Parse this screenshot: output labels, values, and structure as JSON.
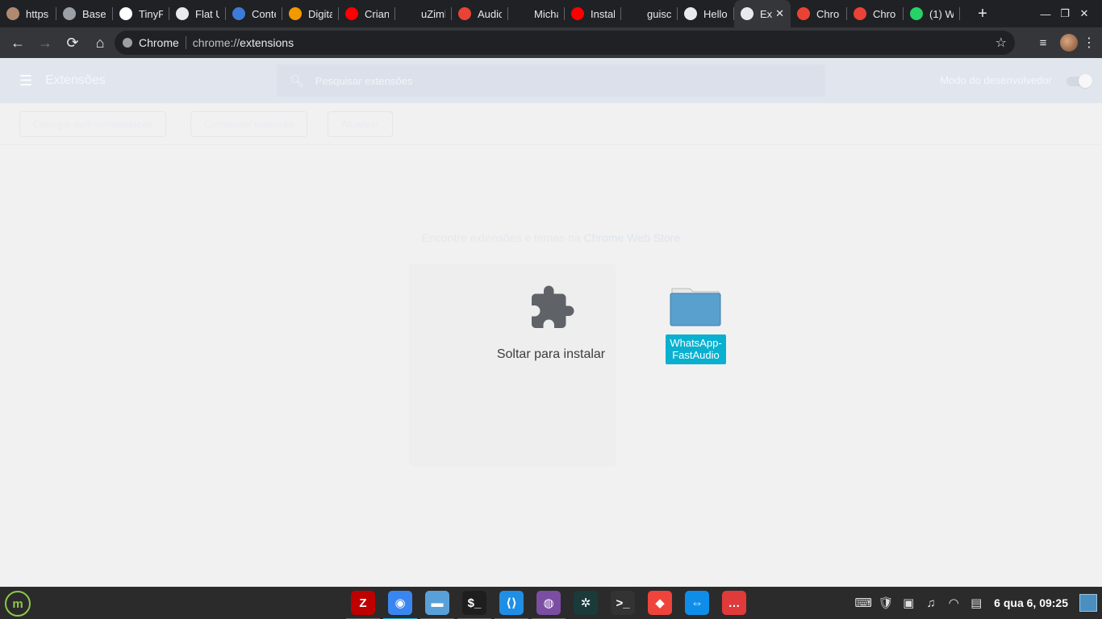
{
  "browser": {
    "tabs": [
      {
        "title": "https",
        "icon": "github-avatar-icon",
        "color": "#b08a70"
      },
      {
        "title": "Baser",
        "icon": "image-icon",
        "color": "#9aa0a6"
      },
      {
        "title": "TinyP",
        "icon": "panda-icon",
        "color": "#ffffff"
      },
      {
        "title": "Flat U",
        "icon": "globe-icon",
        "color": "#e8eaed"
      },
      {
        "title": "Conte",
        "icon": "play-icon",
        "color": "#3d7bd9"
      },
      {
        "title": "Digita",
        "icon": "digital-icon",
        "color": "#f29900"
      },
      {
        "title": "Crian",
        "icon": "youtube-icon",
        "color": "#ff0000"
      },
      {
        "title": "uZiml",
        "icon": "blank-icon",
        "color": "#202124"
      },
      {
        "title": "Audic",
        "icon": "chrome-store-icon",
        "color": "#ea4335"
      },
      {
        "title": "Micha",
        "icon": "blank-icon",
        "color": "#202124"
      },
      {
        "title": "Instal",
        "icon": "youtube-icon",
        "color": "#ff0000"
      },
      {
        "title": "guisc",
        "icon": "blank-icon",
        "color": "#202124"
      },
      {
        "title": "Hello",
        "icon": "github-icon",
        "color": "#e8eaed"
      },
      {
        "title": "Ex",
        "icon": "puzzle-icon",
        "color": "#e8eaed",
        "active": true
      },
      {
        "title": "Chro",
        "icon": "chrome-store-icon",
        "color": "#ea4335"
      },
      {
        "title": "Chro",
        "icon": "chrome-store-icon",
        "color": "#ea4335"
      },
      {
        "title": "(1) W",
        "icon": "whatsapp-icon",
        "color": "#25d366"
      }
    ],
    "omnibox": {
      "site": "Chrome",
      "url_scheme": "chrome://",
      "url_path": "extensions"
    }
  },
  "extensions_page": {
    "title": "Extensões",
    "search_placeholder": "Pesquisar extensões",
    "dev_mode_label": "Modo do desenvolvedor",
    "dev_mode_on": true,
    "actions": {
      "load_unpacked": "Carregar sem compactação",
      "pack": "Compactar extensão",
      "update": "Atualizar"
    },
    "store_text": "Encontre extensões e temas na",
    "store_link": "Chrome Web Store",
    "drop_label": "Soltar para instalar"
  },
  "drag_item": {
    "line1": "WhatsApp-",
    "line2": "FastAudio"
  },
  "taskbar": {
    "apps": [
      {
        "name": "filezilla",
        "color": "#bf0000",
        "glyph": "Z"
      },
      {
        "name": "chrome",
        "color": "#3a86f0",
        "glyph": "◉"
      },
      {
        "name": "files",
        "color": "#5aa0d8",
        "glyph": "▬"
      },
      {
        "name": "terminal",
        "color": "#1e1e1e",
        "glyph": "$_"
      },
      {
        "name": "vscode",
        "color": "#1f8fe5",
        "glyph": "⟨⟩"
      },
      {
        "name": "github-desktop",
        "color": "#7b4ea3",
        "glyph": "◍"
      },
      {
        "name": "gitkraken",
        "color": "#1b3a3a",
        "glyph": "✲"
      },
      {
        "name": "terminal-2",
        "color": "#333333",
        "glyph": ">_"
      },
      {
        "name": "anydesk",
        "color": "#ef443b",
        "glyph": "◆"
      },
      {
        "name": "teamviewer",
        "color": "#0e8ee9",
        "glyph": "⇔"
      },
      {
        "name": "chat",
        "color": "#e03a3a",
        "glyph": "…"
      }
    ],
    "clock": "6 qua  6, 09:25"
  }
}
